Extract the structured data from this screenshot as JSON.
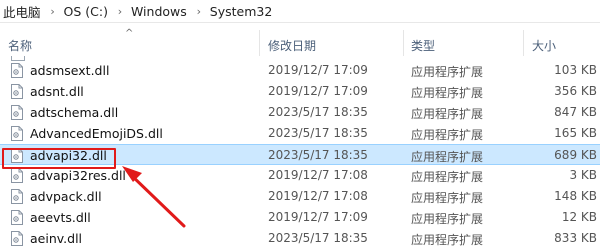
{
  "breadcrumb": {
    "items": [
      "此电脑",
      "OS (C:)",
      "Windows",
      "System32"
    ],
    "separator_icon": "chevron-right-icon"
  },
  "columns": {
    "name": "名称",
    "date": "修改日期",
    "type": "类型",
    "size": "大小",
    "sort_icon": "sort-ascending-chevron-icon"
  },
  "files": [
    {
      "name": "adsmsext.dll",
      "date": "2019/12/7 17:09",
      "type": "应用程序扩展",
      "size": "103 KB",
      "selected": false
    },
    {
      "name": "adsnt.dll",
      "date": "2019/12/7 17:09",
      "type": "应用程序扩展",
      "size": "356 KB",
      "selected": false
    },
    {
      "name": "adtschema.dll",
      "date": "2023/5/17 18:35",
      "type": "应用程序扩展",
      "size": "847 KB",
      "selected": false
    },
    {
      "name": "AdvancedEmojiDS.dll",
      "date": "2023/5/17 18:35",
      "type": "应用程序扩展",
      "size": "165 KB",
      "selected": false
    },
    {
      "name": "advapi32.dll",
      "date": "2023/5/17 18:35",
      "type": "应用程序扩展",
      "size": "689 KB",
      "selected": true
    },
    {
      "name": "advapi32res.dll",
      "date": "2019/12/7 17:08",
      "type": "应用程序扩展",
      "size": "3 KB",
      "selected": false
    },
    {
      "name": "advpack.dll",
      "date": "2019/12/7 17:08",
      "type": "应用程序扩展",
      "size": "148 KB",
      "selected": false
    },
    {
      "name": "aeevts.dll",
      "date": "2019/12/7 17:09",
      "type": "应用程序扩展",
      "size": "12 KB",
      "selected": false
    },
    {
      "name": "aeinv.dll",
      "date": "2023/5/17 18:35",
      "type": "应用程序扩展",
      "size": "833 KB",
      "selected": false
    }
  ],
  "file_icon": "dll-file-icon",
  "annotation": {
    "box_color": "#e11a1a",
    "arrow_color": "#e11a1a",
    "arrow_icon": "red-arrow-icon"
  },
  "colors": {
    "selection_bg": "#cce8ff",
    "selection_border": "#99d1ff",
    "header_text": "#4c607a"
  }
}
